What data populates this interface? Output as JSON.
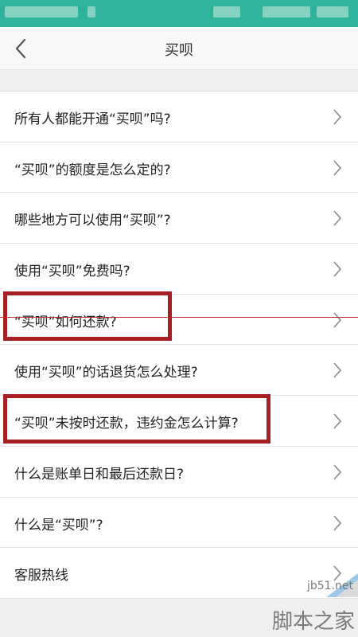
{
  "header": {
    "title": "买呗",
    "back_icon": "chevron-left-icon"
  },
  "faq": {
    "items": [
      {
        "label": "所有人都能开通“买呗”吗?"
      },
      {
        "label": "“买呗”的额度是怎么定的?"
      },
      {
        "label": "哪些地方可以使用“买呗”?"
      },
      {
        "label": "使用“买呗”免费吗?"
      },
      {
        "label": "“买呗”如何还款?"
      },
      {
        "label": "使用“买呗”的话退货怎么处理?"
      },
      {
        "label": "“买呗”未按时还款，违约金怎么计算?"
      },
      {
        "label": "什么是账单日和最后还款日?"
      },
      {
        "label": "什么是“买呗”?"
      },
      {
        "label": "客服热线"
      }
    ],
    "chevron_icon": "chevron-right-icon"
  },
  "watermark": {
    "site": "jb51.net",
    "name": "脚本之家"
  },
  "colors": {
    "status_bar": "#2fb39a",
    "highlight_border": "#a51f24"
  }
}
